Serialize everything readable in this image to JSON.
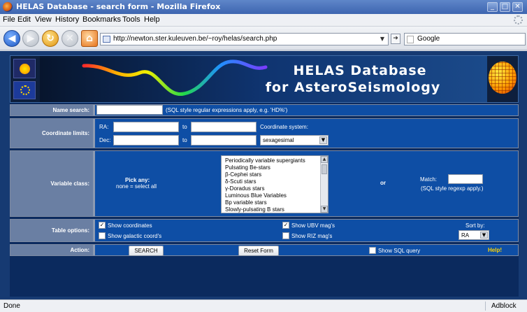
{
  "window": {
    "title": "HELAS Database - search form - Mozilla Firefox",
    "controls": [
      "_",
      "□",
      "✕"
    ]
  },
  "menu": [
    {
      "label": "File",
      "key": "F"
    },
    {
      "label": "Edit",
      "key": "E"
    },
    {
      "label": "View",
      "key": "V"
    },
    {
      "label": "History",
      "key": "s"
    },
    {
      "label": "Bookmarks",
      "key": "B"
    },
    {
      "label": "Tools",
      "key": "T"
    },
    {
      "label": "Help",
      "key": "H"
    }
  ],
  "nav": {
    "url": "http://newton.ster.kuleuven.be/~roy/helas/search.php",
    "search_engine": "Google"
  },
  "banner": {
    "title_line1": "HELAS Database",
    "title_line2": "for AsteroSeismology"
  },
  "form": {
    "name_search": {
      "label": "Name search:",
      "value": "",
      "hint": "(SQL style regular expressions apply, e.g. 'HD%')"
    },
    "coordinate_limits": {
      "label": "Coordinate limits:",
      "ra_label": "RA:",
      "dec_label": "Dec:",
      "to_label": "to",
      "system_label": "Coordinate system:",
      "system_value": "sexagesimal"
    },
    "variable_class": {
      "label": "Variable class:",
      "pick_title": "Pick any:",
      "pick_hint": "none = select all",
      "options": [
        "Periodically variable supergiants",
        "Pulsating Be-stars",
        "β-Cephei stars",
        "δ-Scuti stars",
        "γ-Doradus stars",
        "Luminous Blue Variables",
        "Bp variable stars",
        "Slowly-pulsating B stars"
      ],
      "or_label": "or",
      "match_label": "Match:",
      "match_value": "",
      "match_hint": "(SQL style regexp apply.)"
    },
    "table_options": {
      "label": "Table options:",
      "show_coordinates": "Show coordinates",
      "show_coordinates_checked": true,
      "show_galactic": "Show galactic coord's",
      "show_galactic_checked": false,
      "show_ubv": "Show UBV mag's",
      "show_ubv_checked": true,
      "show_riz": "Show RIZ mag's",
      "show_riz_checked": false,
      "sort_by_label": "Sort by:",
      "sort_by_value": "RA"
    },
    "action": {
      "label": "Action:",
      "search_button": "SEARCH",
      "reset_button": "Reset Form",
      "show_sql": "Show SQL query",
      "show_sql_checked": false,
      "help_link": "Help!"
    }
  },
  "status": {
    "text": "Done",
    "addon": "Adblock"
  },
  "colors": {
    "page_bg": "#163a72",
    "row_label_bg": "#6a7fa3",
    "row_value_bg": "#0e4ea5",
    "help_link": "#ffd400"
  }
}
